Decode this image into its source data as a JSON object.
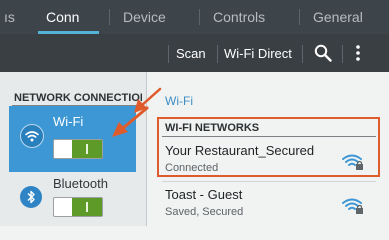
{
  "tabs": [
    {
      "label": "ıs",
      "active": false
    },
    {
      "label": "Conn",
      "active": true
    },
    {
      "label": "Device",
      "active": false
    },
    {
      "label": "Controls",
      "active": false
    },
    {
      "label": "General",
      "active": false
    }
  ],
  "actionbar": {
    "scan_label": "Scan",
    "wifi_direct_label": "Wi-Fi Direct",
    "search_icon": "search-icon",
    "overflow_icon": "overflow-menu-icon"
  },
  "sidebar": {
    "section_header": "NETWORK CONNECTIONS",
    "items": [
      {
        "label": "Wi-Fi",
        "icon": "wifi-icon",
        "toggle_on": true,
        "selected": true
      },
      {
        "label": "Bluetooth",
        "icon": "bluetooth-icon",
        "toggle_on": true,
        "selected": false
      }
    ]
  },
  "main": {
    "title": "Wi-Fi",
    "networks_header": "WI-FI NETWORKS",
    "networks": [
      {
        "name": "Your Restaurant_Secured",
        "status": "Connected",
        "icon": "wifi-lock-icon"
      },
      {
        "name": "Toast - Guest",
        "status": "Saved, Secured",
        "icon": "wifi-lock-icon"
      }
    ]
  },
  "colors": {
    "accent": "#3d97d4",
    "annotation": "#e05b2c",
    "toggle_on": "#5d9a27",
    "tab_indicator": "#54b4d6"
  }
}
